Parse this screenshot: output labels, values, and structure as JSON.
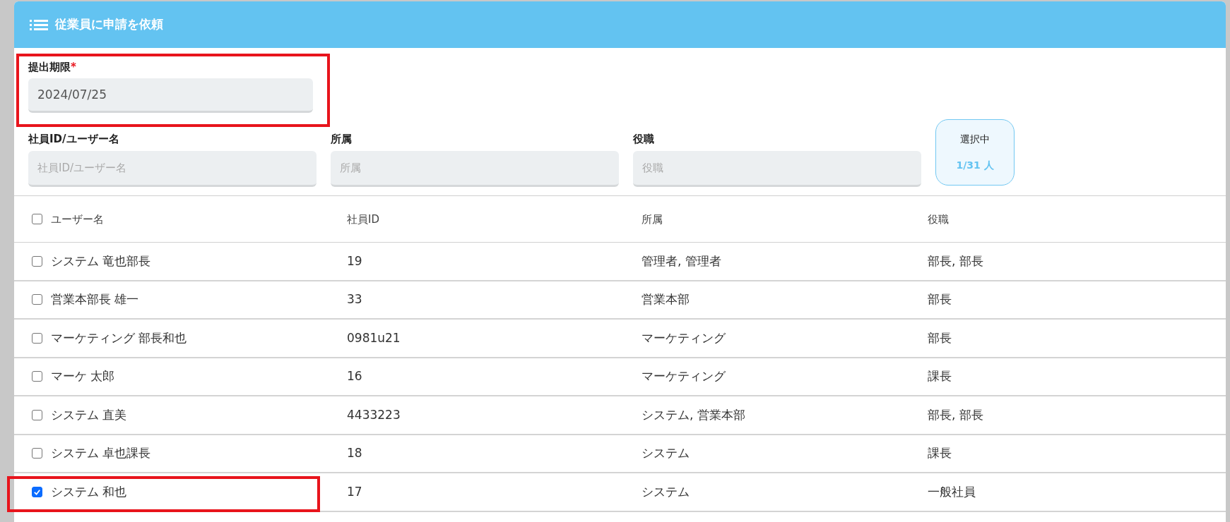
{
  "dialog": {
    "title": "従業員に申請を依頼"
  },
  "deadline": {
    "label": "提出期限",
    "required_mark": "*",
    "value": "2024/07/25",
    "highlighted": true
  },
  "filters": [
    {
      "label": "社員ID/ユーザー名",
      "placeholder": "社員ID/ユーザー名"
    },
    {
      "label": "所属",
      "placeholder": "所属"
    },
    {
      "label": "役職",
      "placeholder": "役職"
    }
  ],
  "selection": {
    "label": "選択中",
    "count": "1/31 人"
  },
  "table": {
    "all_checked": false,
    "columns": [
      "ユーザー名",
      "社員ID",
      "所属",
      "役職"
    ],
    "rows": [
      {
        "checked": false,
        "highlighted": false,
        "cells": [
          "システム 竜也部長",
          "19",
          "管理者, 管理者",
          "部長, 部長"
        ]
      },
      {
        "checked": false,
        "highlighted": false,
        "cells": [
          "営業本部長 雄一",
          "33",
          "営業本部",
          "部長"
        ]
      },
      {
        "checked": false,
        "highlighted": false,
        "cells": [
          "マーケティング 部長和也",
          "0981u21",
          "マーケティング",
          "部長"
        ]
      },
      {
        "checked": false,
        "highlighted": false,
        "cells": [
          "マーケ 太郎",
          "16",
          "マーケティング",
          "課長"
        ]
      },
      {
        "checked": false,
        "highlighted": false,
        "cells": [
          "システム 直美",
          "4433223",
          "システム, 営業本部",
          "部長, 部長"
        ]
      },
      {
        "checked": false,
        "highlighted": false,
        "cells": [
          "システム 卓也課長",
          "18",
          "システム",
          "課長"
        ]
      },
      {
        "checked": true,
        "highlighted": true,
        "cells": [
          "システム 和也",
          "17",
          "システム",
          "一般社員"
        ]
      }
    ]
  }
}
